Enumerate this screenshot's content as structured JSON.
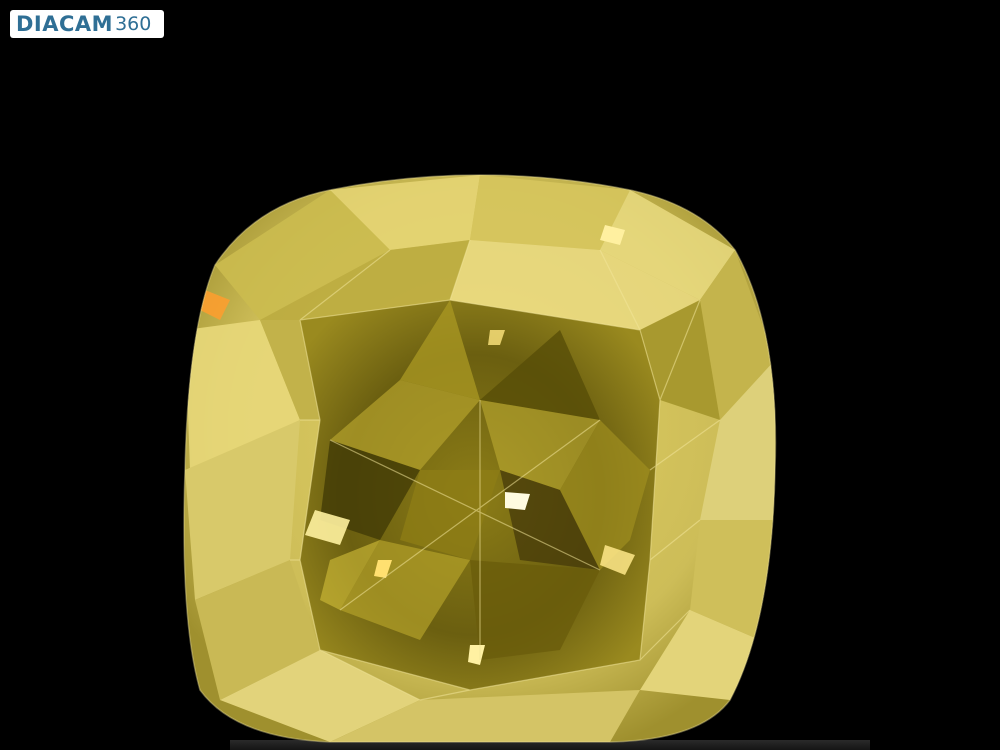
{
  "logo": {
    "brand": "DIACAM",
    "suffix": "360",
    "color": "#2f6f95"
  },
  "subject": {
    "name": "diamond",
    "body_color": "#d8c760",
    "table_color": "#6d6212",
    "background_color": "#000000"
  }
}
